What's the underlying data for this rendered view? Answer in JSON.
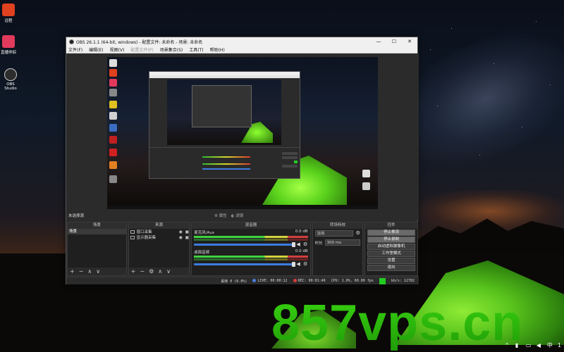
{
  "desktop": {
    "icons": [
      {
        "label": "远程",
        "color": "#e0411e"
      },
      {
        "label": "直播伴侣",
        "color": "#e23a5c"
      },
      {
        "label": "OBS Studio",
        "color": "#2d2d2d"
      }
    ],
    "watermark": "857vps.cn",
    "tray": {
      "ime": "中",
      "clock": "1"
    }
  },
  "obs": {
    "title": "OBS 26.1.1 (64-bit, windows) - 配置文件: 未命名 - 场景: 未命名",
    "window_controls": {
      "minimize": "—",
      "maximize": "☐",
      "close": "✕"
    },
    "menu": [
      "文件(F)",
      "编辑(E)",
      "视图(V)",
      "配置文件(P)",
      "场景集合(S)",
      "工具(T)",
      "帮助(H)"
    ],
    "source_toolbar": {
      "label": "未选择源",
      "properties": "属性",
      "filters": "滤镜"
    },
    "docks": {
      "scenes": {
        "title": "场景",
        "items": [
          "场景"
        ]
      },
      "sources": {
        "title": "来源",
        "items": [
          {
            "label": "窗口采集"
          },
          {
            "label": "显示器采集"
          }
        ]
      },
      "mixer": {
        "title": "混音器",
        "channels": [
          {
            "name": "麦克风/Aux",
            "db": "0.0 dB"
          },
          {
            "name": "桌面音频",
            "db": "0.0 dB"
          }
        ]
      },
      "transitions": {
        "title": "转场特效",
        "selected": "淡出",
        "duration_label": "时长",
        "duration_value": "300 ms"
      },
      "controls": {
        "title": "控件",
        "buttons": [
          "停止推流",
          "停止录制",
          "启动虚拟摄像机",
          "工作室模式",
          "设置",
          "退出"
        ]
      }
    },
    "status": {
      "dropped": "丢帧 0 (0.0%)",
      "live": "LIVE: 00:00:12",
      "rec": "REC: 00:01:40",
      "cpu": "CPU: 1.0%, 60.00 fps",
      "kbps": "kb/s: 12782"
    }
  }
}
